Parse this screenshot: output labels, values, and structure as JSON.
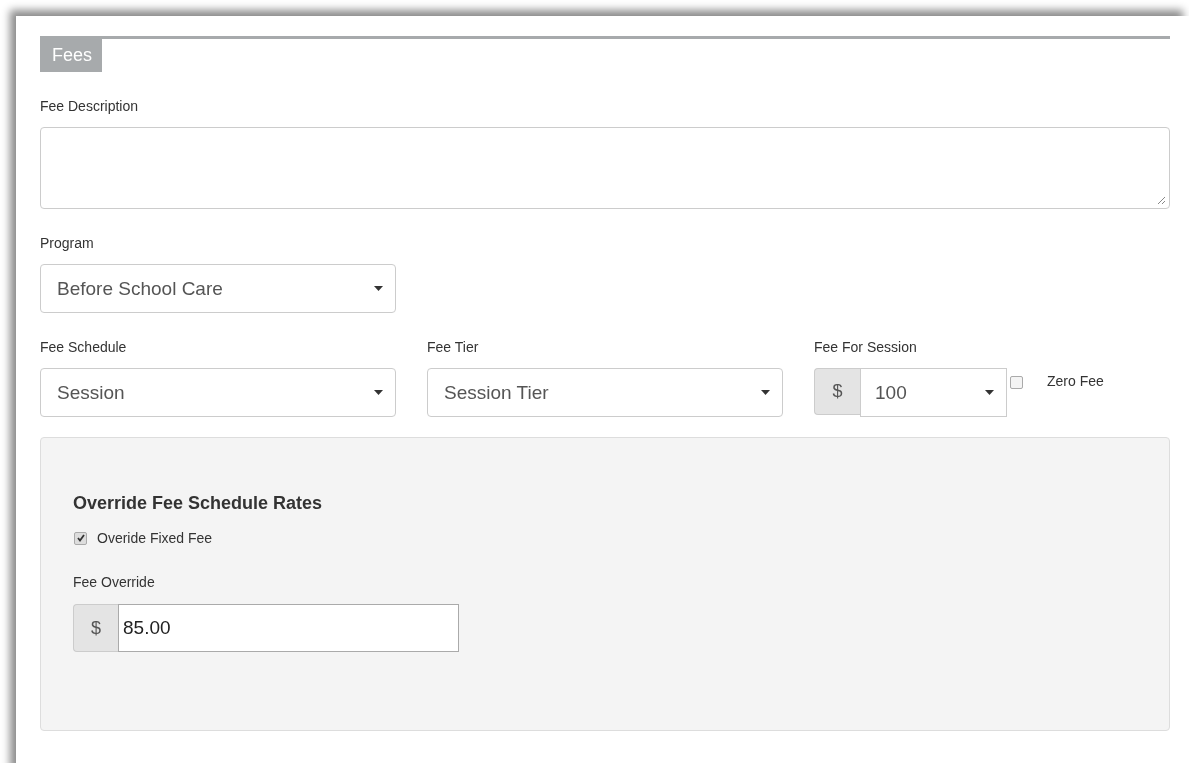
{
  "section": {
    "title": "Fees"
  },
  "description": {
    "label": "Fee Description"
  },
  "program": {
    "label": "Program",
    "value": "Before School Care"
  },
  "selects": [
    {
      "kind": "select",
      "label": "Fee Schedule",
      "value": "Session"
    },
    {
      "kind": "select",
      "label": "Fee Tier",
      "value": "Session Tier"
    },
    {
      "kind": "money",
      "label": "Fee For Session",
      "prefix": "$",
      "value": "100",
      "checkbox": {
        "label": "Zero Fee",
        "checked": false
      }
    }
  ],
  "override": {
    "title": "Override Fee Schedule Rates",
    "checkbox": {
      "label": "Overide Fixed Fee",
      "checked": true
    },
    "field": {
      "label": "Fee Override",
      "prefix": "$",
      "value": "85.00"
    }
  }
}
